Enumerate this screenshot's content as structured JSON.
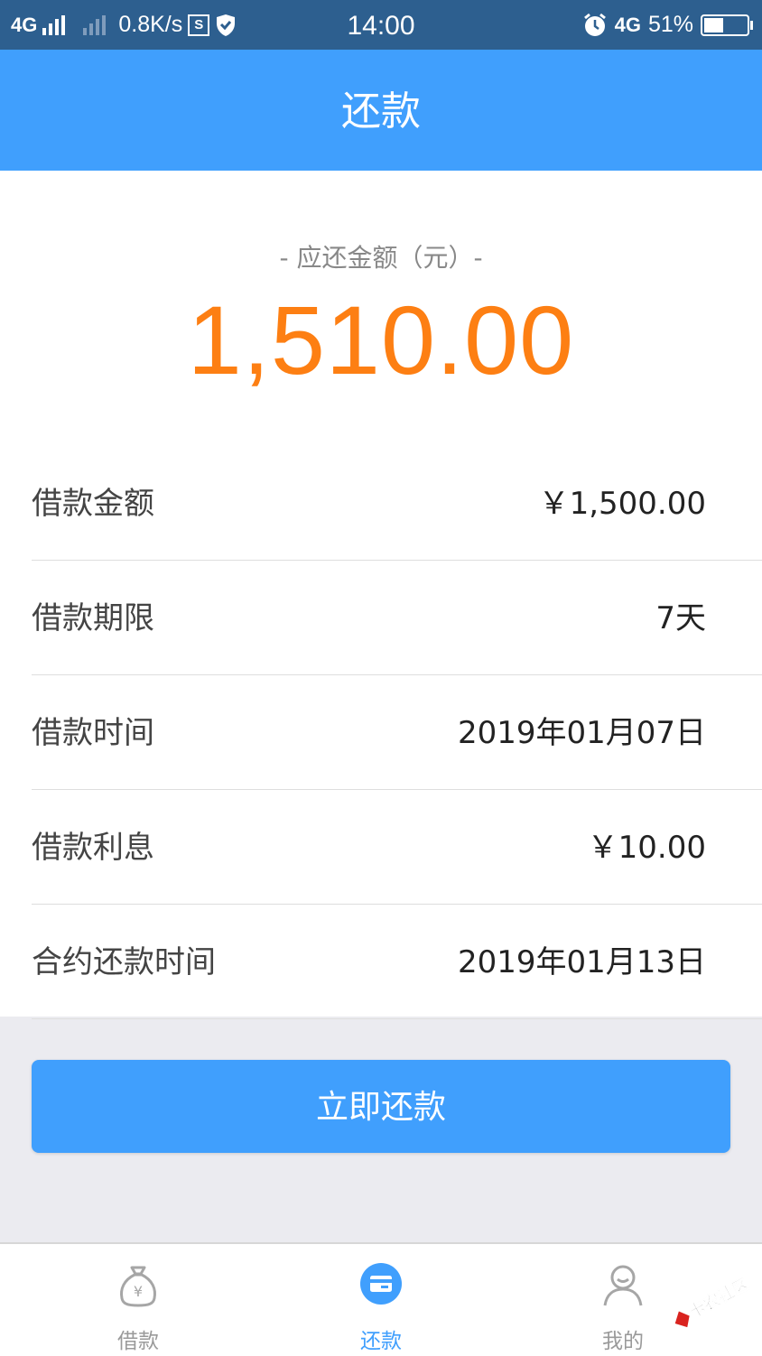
{
  "status_bar": {
    "network_left": "4G",
    "speed": "0.8K/s",
    "s_icon": "S",
    "time": "14:00",
    "network_right": "4G",
    "battery": "51%",
    "battery_level": 0.51
  },
  "header": {
    "title": "还款"
  },
  "summary": {
    "caption": "- 应还金额（元）-",
    "amount": "1,510.00",
    "amount_color": "#fd7f13"
  },
  "details": [
    {
      "label": "借款金额",
      "value": "￥1,500.00"
    },
    {
      "label": "借款期限",
      "value": "7天"
    },
    {
      "label": "借款时间",
      "value": "2019年01月07日"
    },
    {
      "label": "借款利息",
      "value": "￥10.00"
    },
    {
      "label": "合约还款时间",
      "value": "2019年01月13日"
    }
  ],
  "pay_button": {
    "label": "立即还款"
  },
  "tabs": [
    {
      "label": "借款",
      "icon": "money-bag-icon",
      "active": false
    },
    {
      "label": "还款",
      "icon": "card-icon",
      "active": true
    },
    {
      "label": "我的",
      "icon": "user-icon",
      "active": false
    }
  ],
  "watermark": {
    "text": "卡农社区"
  },
  "colors": {
    "primary": "#409ffd",
    "status_bar": "#2d5f8f",
    "accent": "#fd7f13"
  }
}
